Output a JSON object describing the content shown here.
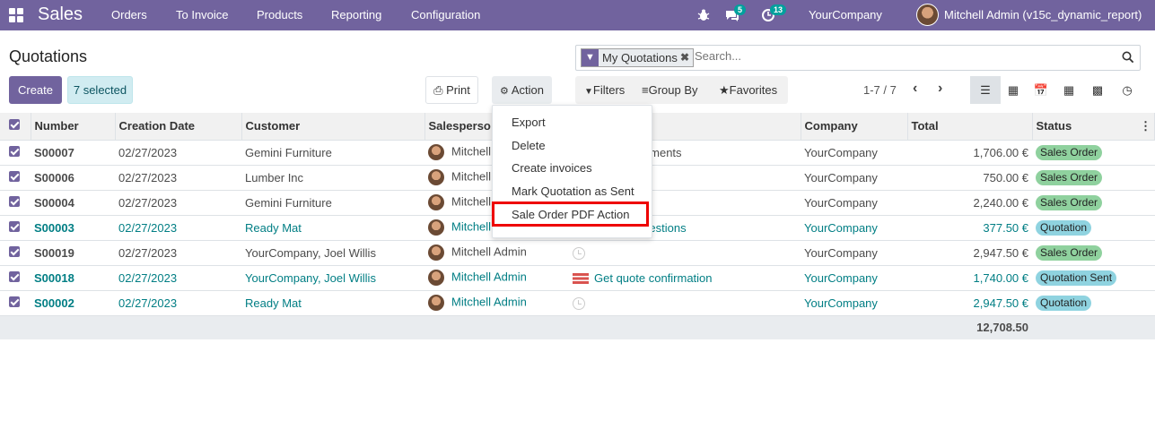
{
  "navbar": {
    "brand": "Sales",
    "menu": [
      "Orders",
      "To Invoice",
      "Products",
      "Reporting",
      "Configuration"
    ],
    "chat_count": "5",
    "activity_count": "13",
    "company": "YourCompany",
    "user": "Mitchell Admin (v15c_dynamic_report)",
    "bg_color": "#71639e"
  },
  "control": {
    "title": "Quotations",
    "create_label": "Create",
    "selected_label": "7 selected",
    "print_label": "Print",
    "action_label": "Action",
    "search_facet": "My Quotations",
    "search_placeholder": "Search...",
    "filters_label": "Filters",
    "groupby_label": "Group By",
    "favorites_label": "Favorites",
    "pager": "1-7 / 7",
    "views": [
      "list-icon",
      "kanban-icon",
      "calendar-icon",
      "pivot-icon",
      "graph-icon",
      "activity-view-icon"
    ]
  },
  "action_menu": {
    "items": [
      "Export",
      "Delete",
      "Create invoices",
      "Mark Quotation as Sent",
      "Sale Order PDF Action"
    ],
    "highlighted": "Sale Order PDF Action"
  },
  "table": {
    "headers": {
      "number": "Number",
      "creation_date": "Creation Date",
      "customer": "Customer",
      "salesperson": "Salesperso",
      "activities": "",
      "company": "Company",
      "total": "Total",
      "status": "Status"
    },
    "rows": [
      {
        "number": "S00007",
        "date": "02/27/2023",
        "customer": "Gemini Furniture",
        "salesperson": "Mitchell",
        "activity": "ery requirements",
        "company": "YourCompany",
        "total": "1,706.00 €",
        "status": "Sales Order"
      },
      {
        "number": "S00006",
        "date": "02/27/2023",
        "customer": "Lumber Inc",
        "salesperson": "Mitchell",
        "activity": "",
        "company": "YourCompany",
        "total": "750.00 €",
        "status": "Sales Order"
      },
      {
        "number": "S00004",
        "date": "02/27/2023",
        "customer": "Gemini Furniture",
        "salesperson": "Mitchell",
        "activity": "ll",
        "company": "YourCompany",
        "total": "2,240.00 €",
        "status": "Sales Order"
      },
      {
        "number": "S00003",
        "date": "02/27/2023",
        "customer": "Ready Mat",
        "salesperson": "Mitchell Admin",
        "activity": "Answer questions",
        "company": "YourCompany",
        "total": "377.50 €",
        "status": "Quotation"
      },
      {
        "number": "S00019",
        "date": "02/27/2023",
        "customer": "YourCompany, Joel Willis",
        "salesperson": "Mitchell Admin",
        "activity": "",
        "company": "YourCompany",
        "total": "2,947.50 €",
        "status": "Sales Order"
      },
      {
        "number": "S00018",
        "date": "02/27/2023",
        "customer": "YourCompany, Joel Willis",
        "salesperson": "Mitchell Admin",
        "activity": "Get quote confirmation",
        "company": "YourCompany",
        "total": "1,740.00 €",
        "status": "Quotation Sent"
      },
      {
        "number": "S00002",
        "date": "02/27/2023",
        "customer": "Ready Mat",
        "salesperson": "Mitchell Admin",
        "activity": "",
        "company": "YourCompany",
        "total": "2,947.50 €",
        "status": "Quotation"
      }
    ],
    "sum_total": "12,708.50",
    "status_colors": {
      "Sales Order": "#8fd19e",
      "Quotation": "#8fd3e0",
      "Quotation Sent": "#8fd3e0"
    }
  }
}
